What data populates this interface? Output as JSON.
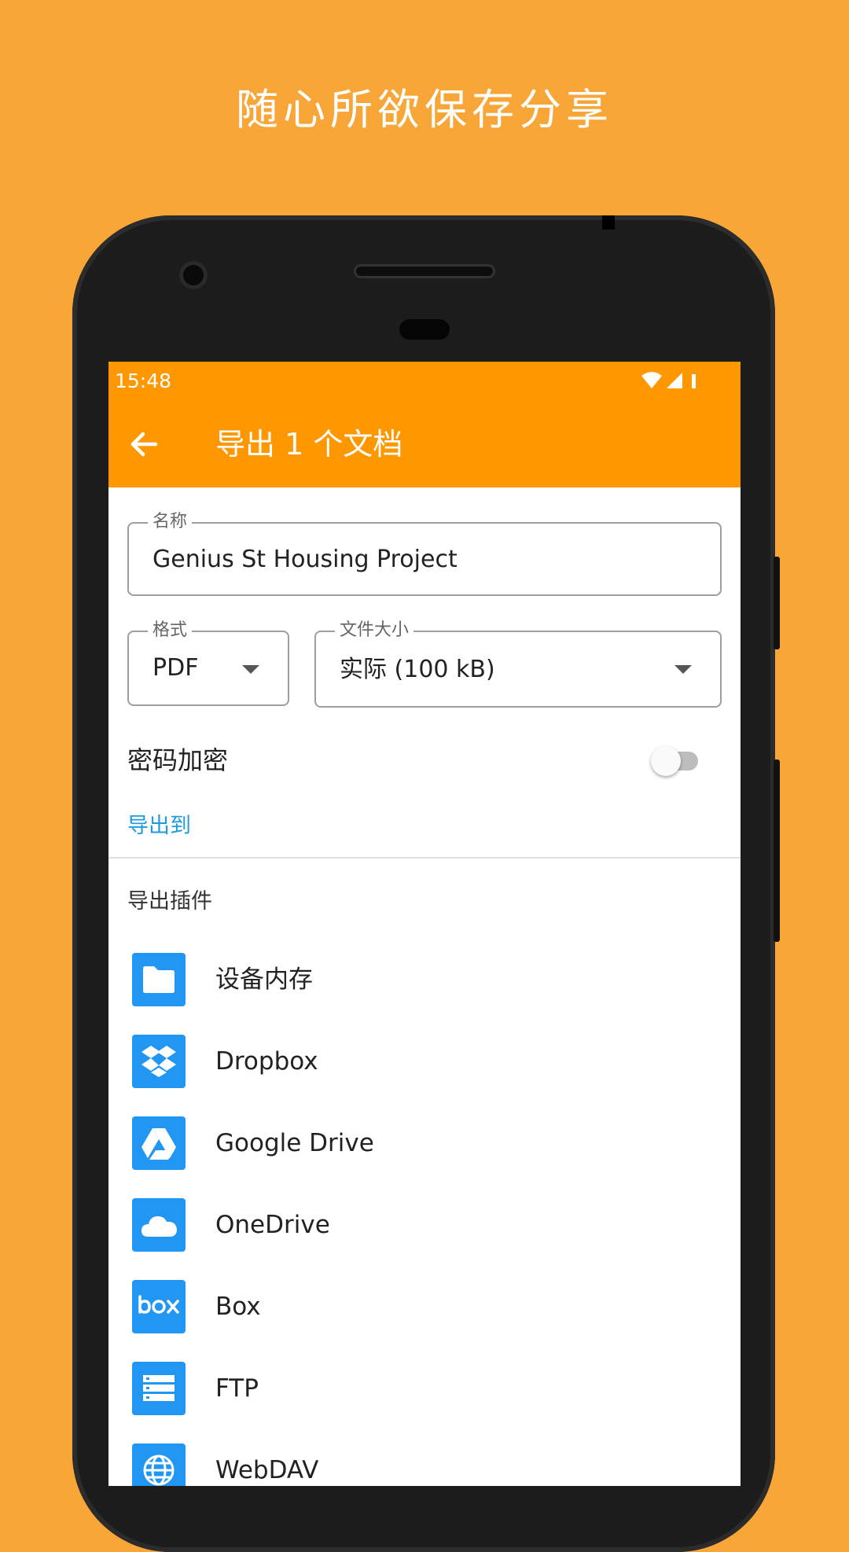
{
  "headline": "随心所欲保存分享",
  "status": {
    "time": "15:48"
  },
  "appbar": {
    "title": "导出 1 个文档"
  },
  "form": {
    "name_label": "名称",
    "name_value": "Genius St Housing Project",
    "format_label": "格式",
    "format_value": "PDF",
    "size_label": "文件大小",
    "size_value": "实际 (100 kB)",
    "password_label": "密码加密",
    "password_enabled": false,
    "export_to": "导出到"
  },
  "plugins": {
    "title": "导出插件",
    "items": [
      {
        "label": "设备内存",
        "icon": "folder-icon"
      },
      {
        "label": "Dropbox",
        "icon": "dropbox-icon"
      },
      {
        "label": "Google Drive",
        "icon": "google-drive-icon"
      },
      {
        "label": "OneDrive",
        "icon": "onedrive-icon"
      },
      {
        "label": "Box",
        "icon": "box-icon"
      },
      {
        "label": "FTP",
        "icon": "ftp-server-icon"
      },
      {
        "label": "WebDAV",
        "icon": "globe-icon"
      }
    ]
  },
  "colors": {
    "background": "#F8A637",
    "appbar": "#FF9800",
    "accent": "#1E9BE0",
    "icon_tile": "#2196F3"
  }
}
